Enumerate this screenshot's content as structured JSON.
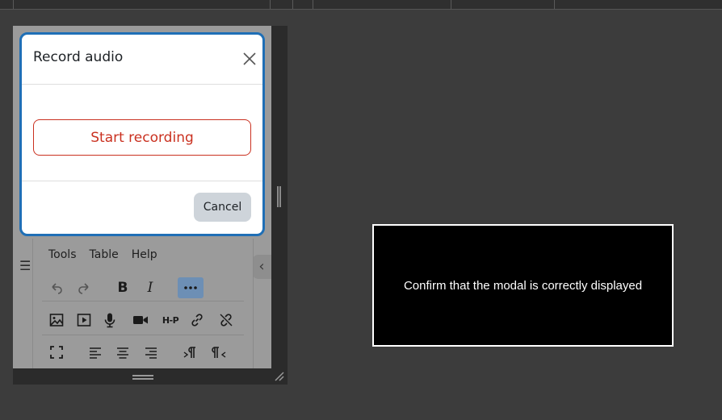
{
  "modal": {
    "title": "Record audio",
    "start_label": "Start recording",
    "cancel_label": "Cancel"
  },
  "editor": {
    "menu": [
      "Tools",
      "Table",
      "Help"
    ],
    "toolbar_rows": [
      [
        "undo-icon",
        "redo-icon",
        "bold-icon",
        "italic-icon",
        "more-icon"
      ],
      [
        "image-icon",
        "media-icon",
        "microphone-icon",
        "video-camera-icon",
        "h5p-icon",
        "link-icon",
        "unlink-icon"
      ],
      [
        "fullscreen-icon",
        "align-left-icon",
        "align-center-icon",
        "align-right-icon",
        "ltr-icon",
        "rtl-icon"
      ]
    ],
    "h5p_label": "H-P",
    "bold_label": "B",
    "italic_label": "I"
  },
  "notice": {
    "text": "Confirm that the modal is correctly displayed"
  },
  "colors": {
    "modal_border": "#1f6fb6",
    "start_button": "#ca3120",
    "cancel_button": "#ced4da",
    "active_tool": "#6d8fb5"
  }
}
